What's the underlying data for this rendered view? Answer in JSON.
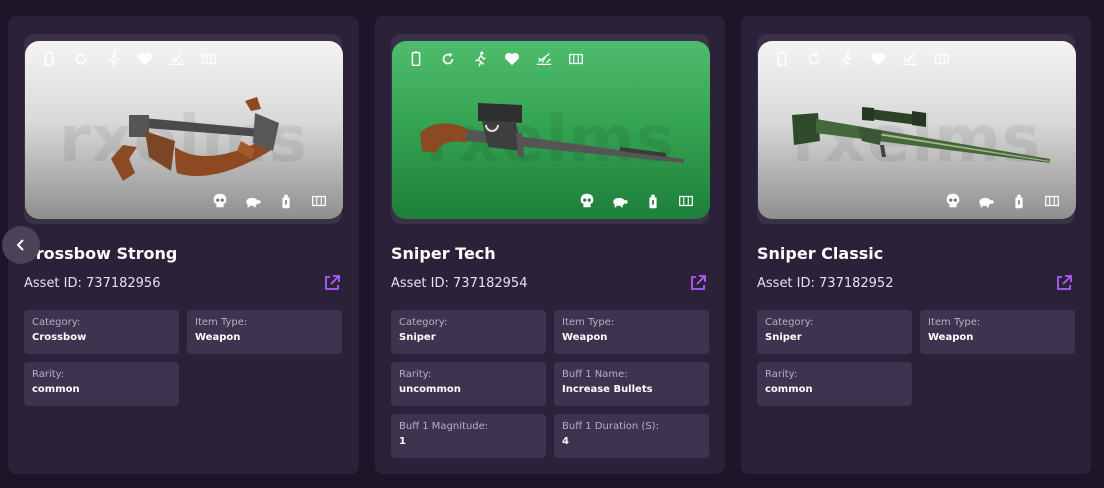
{
  "watermark": "rxelms",
  "icons": {
    "top": [
      "battery-icon",
      "reload-icon",
      "running-icon",
      "heart-icon",
      "impact-icon",
      "magazine-icon"
    ],
    "bottom": [
      "skull-icon",
      "turtle-icon",
      "ammo-icon",
      "magazine-icon"
    ]
  },
  "colors": {
    "page_bg": "#1d1628",
    "card_bg": "#2b223a",
    "field_bg": "#3d3450",
    "accent_link": "#b45bff",
    "green_thumb": "#36a553"
  },
  "cards": [
    {
      "title": "Crossbow Strong",
      "asset_id": "Asset ID: 737182956",
      "thumbnail_style": "gray",
      "fields": [
        {
          "label": "Category:",
          "value": "Crossbow"
        },
        {
          "label": "Item Type:",
          "value": "Weapon"
        },
        {
          "label": "Rarity:",
          "value": "common"
        }
      ]
    },
    {
      "title": "Sniper Tech",
      "asset_id": "Asset ID: 737182954",
      "thumbnail_style": "green",
      "fields": [
        {
          "label": "Category:",
          "value": "Sniper"
        },
        {
          "label": "Item Type:",
          "value": "Weapon"
        },
        {
          "label": "Rarity:",
          "value": "uncommon"
        },
        {
          "label": "Buff 1 Name:",
          "value": "Increase Bullets"
        },
        {
          "label": "Buff 1 Magnitude:",
          "value": "1"
        },
        {
          "label": "Buff 1 Duration (S):",
          "value": "4"
        }
      ]
    },
    {
      "title": "Sniper Classic",
      "asset_id": "Asset ID: 737182952",
      "thumbnail_style": "gray",
      "fields": [
        {
          "label": "Category:",
          "value": "Sniper"
        },
        {
          "label": "Item Type:",
          "value": "Weapon"
        },
        {
          "label": "Rarity:",
          "value": "common"
        }
      ]
    }
  ]
}
